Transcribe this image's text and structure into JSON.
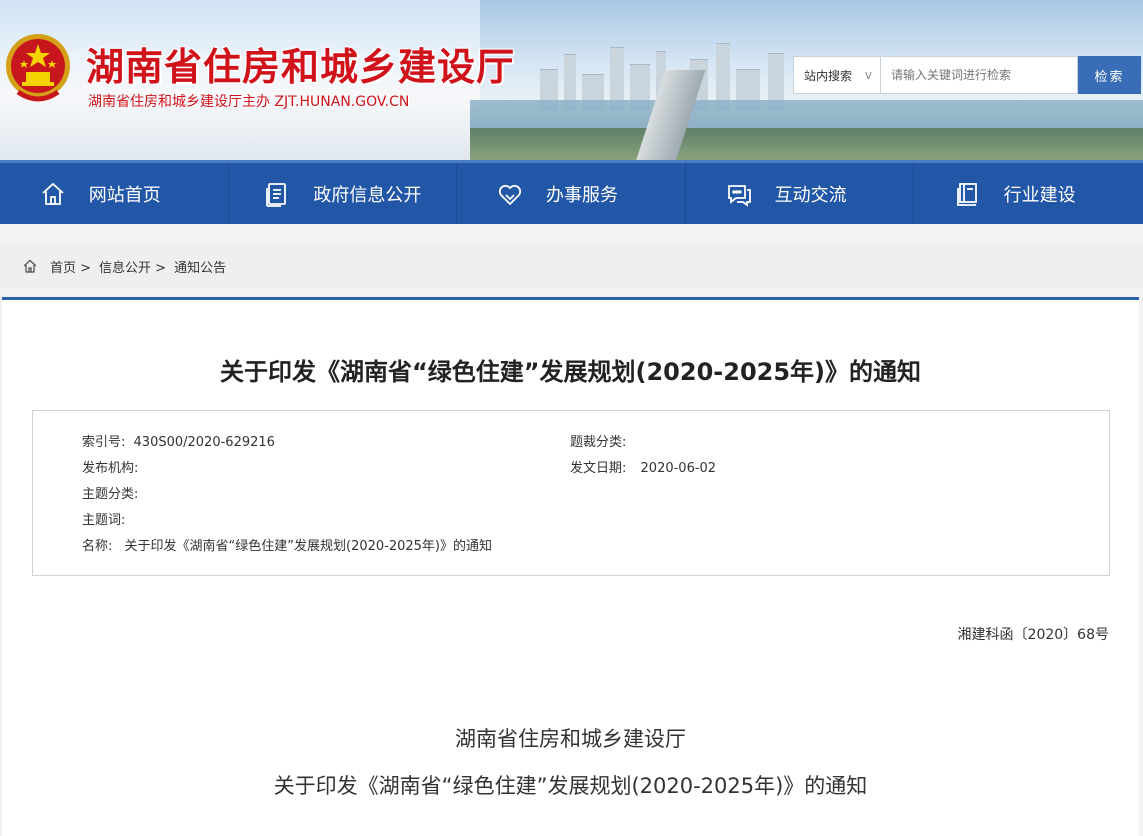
{
  "header": {
    "site_title": "湖南省住房和城乡建设厅",
    "site_subtitle": "湖南省住房和城乡建设厅主办  ZJT.HUNAN.GOV.CN",
    "emblem_icon": "national-emblem-icon"
  },
  "search": {
    "scope_label": "站内搜索",
    "scope_arrow": "v",
    "placeholder": "请输入关键词进行检索",
    "button_label": "检索"
  },
  "nav": {
    "items": [
      {
        "label": "网站首页",
        "icon": "home-icon"
      },
      {
        "label": "政府信息公开",
        "icon": "document-icon"
      },
      {
        "label": "办事服务",
        "icon": "heart-icon"
      },
      {
        "label": "互动交流",
        "icon": "chat-icon"
      },
      {
        "label": "行业建设",
        "icon": "book-icon"
      }
    ]
  },
  "breadcrumb": {
    "items": [
      "首页 >",
      "信息公开 >",
      "通知公告"
    ]
  },
  "document": {
    "title": "关于印发《湖南省“绿色住建”发展规划(2020-2025年)》的通知",
    "meta": {
      "index_label": "索引号:",
      "index_value": "430S00/2020-629216",
      "topic_class_label": "题裁分类:",
      "topic_class_value": "",
      "publisher_label": "发布机构:",
      "publisher_value": "",
      "date_label": "发文日期:",
      "date_value": "2020-06-02",
      "subject_label": "主题分类:",
      "subject_value": "",
      "keywords_label": "主题词:",
      "keywords_value": "",
      "name_label": "名称:",
      "name_value": "关于印发《湖南省“绿色住建”发展规划(2020-2025年)》的通知"
    },
    "doc_number": "湘建科函〔2020〕68号",
    "body_org": "湖南省住房和城乡建设厅",
    "body_title": "关于印发《湖南省“绿色住建”发展规划(2020-2025年)》的通知"
  },
  "colors": {
    "brand_red": "#d0121b",
    "nav_blue": "#2257a8",
    "accent_blue": "#2b62ad",
    "search_button": "#3a6db8"
  }
}
